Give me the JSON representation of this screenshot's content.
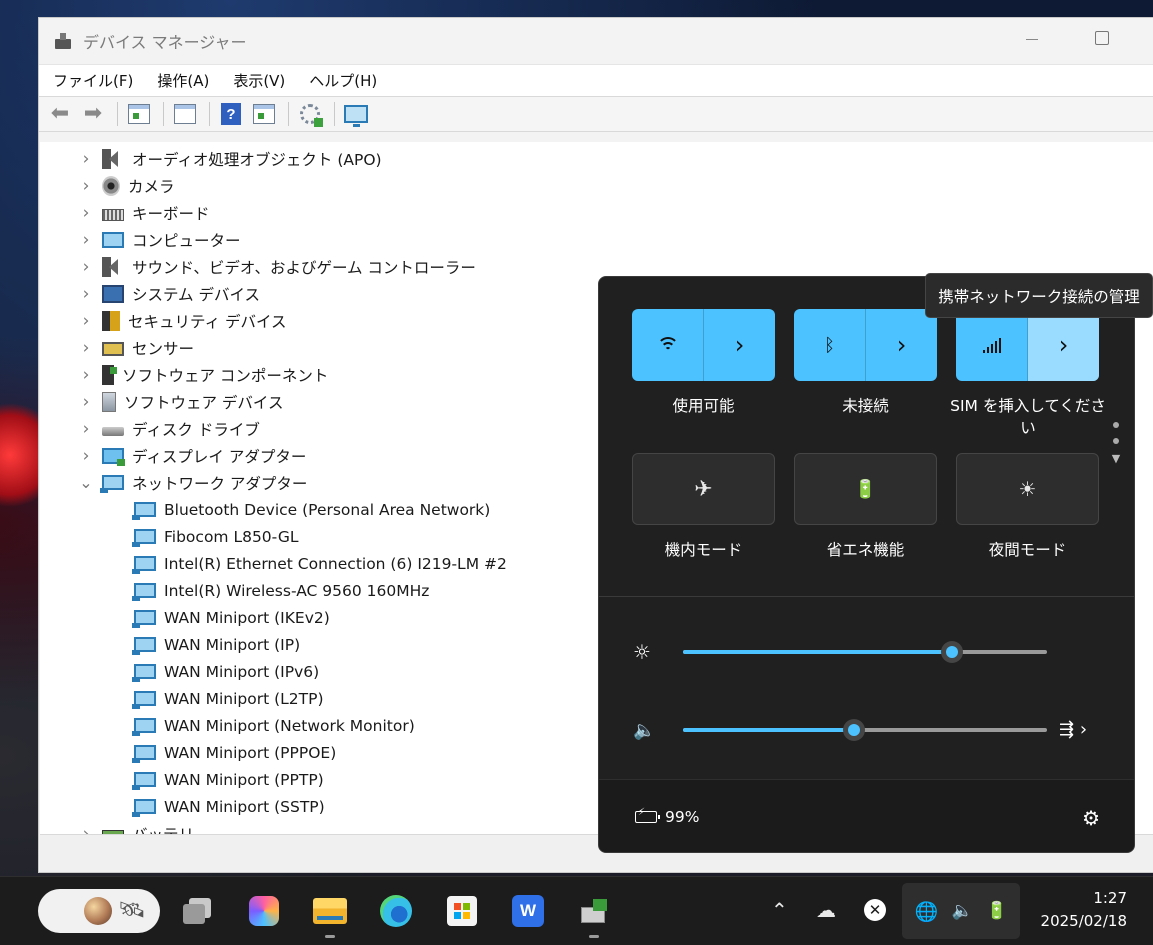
{
  "window": {
    "title": "デバイス マネージャー",
    "menu": [
      "ファイル(F)",
      "操作(A)",
      "表示(V)",
      "ヘルプ(H)"
    ]
  },
  "toolbar": {
    "icons": [
      "back-arrow-icon",
      "forward-arrow-icon",
      "properties-icon",
      "update-icon",
      "help-icon",
      "view-icon",
      "scan-hardware-icon",
      "monitor-icon"
    ]
  },
  "tree": {
    "categories": [
      {
        "label": "オーディオ処理オブジェクト (APO)",
        "icon": "speaker-icon",
        "expanded": false
      },
      {
        "label": "カメラ",
        "icon": "camera-icon",
        "expanded": false
      },
      {
        "label": "キーボード",
        "icon": "keyboard-icon",
        "expanded": false
      },
      {
        "label": "コンピューター",
        "icon": "computer-icon",
        "expanded": false
      },
      {
        "label": "サウンド、ビデオ、およびゲーム コントローラー",
        "icon": "speaker-icon",
        "expanded": false
      },
      {
        "label": "システム デバイス",
        "icon": "system-device-icon",
        "expanded": false
      },
      {
        "label": "セキュリティ デバイス",
        "icon": "security-device-icon",
        "expanded": false
      },
      {
        "label": "センサー",
        "icon": "sensor-icon",
        "expanded": false
      },
      {
        "label": "ソフトウェア コンポーネント",
        "icon": "software-component-icon",
        "expanded": false
      },
      {
        "label": "ソフトウェア デバイス",
        "icon": "software-device-icon",
        "expanded": false
      },
      {
        "label": "ディスク ドライブ",
        "icon": "disk-drive-icon",
        "expanded": false
      },
      {
        "label": "ディスプレイ アダプター",
        "icon": "display-adapter-icon",
        "expanded": false
      },
      {
        "label": "ネットワーク アダプター",
        "icon": "network-adapter-icon",
        "expanded": true
      }
    ],
    "network_adapters": [
      "Bluetooth Device (Personal Area Network)",
      "Fibocom L850-GL",
      "Intel(R) Ethernet Connection (6) I219-LM #2",
      "Intel(R) Wireless-AC 9560 160MHz",
      "WAN Miniport (IKEv2)",
      "WAN Miniport (IP)",
      "WAN Miniport (IPv6)",
      "WAN Miniport (L2TP)",
      "WAN Miniport (Network Monitor)",
      "WAN Miniport (PPPOE)",
      "WAN Miniport (PPTP)",
      "WAN Miniport (SSTP)"
    ],
    "partial_last": "バッテリ"
  },
  "quick_settings": {
    "tiles": [
      {
        "label": "使用可能",
        "icon": "wifi-icon",
        "state": "on"
      },
      {
        "label": "未接続",
        "icon": "bluetooth-icon",
        "state": "on"
      },
      {
        "label": "SIM を挿入してください",
        "icon": "cellular-icon",
        "state": "on"
      },
      {
        "label": "機内モード",
        "icon": "airplane-icon",
        "state": "off"
      },
      {
        "label": "省エネ機能",
        "icon": "energy-saver-icon",
        "state": "off"
      },
      {
        "label": "夜間モード",
        "icon": "night-light-icon",
        "state": "off"
      }
    ],
    "brightness_level": 0.74,
    "volume_level": 0.47,
    "battery_text": "99%",
    "accent_color": "#4cc2ff"
  },
  "tooltip": "携帯ネットワーク接続の管理",
  "taskbar": {
    "apps": [
      "widgets",
      "task-view",
      "copilot",
      "file-explorer",
      "edge",
      "microsoft-store",
      "wps-office",
      "device-manager"
    ],
    "clock_time": "1:27",
    "clock_date": "2025/02/18"
  }
}
